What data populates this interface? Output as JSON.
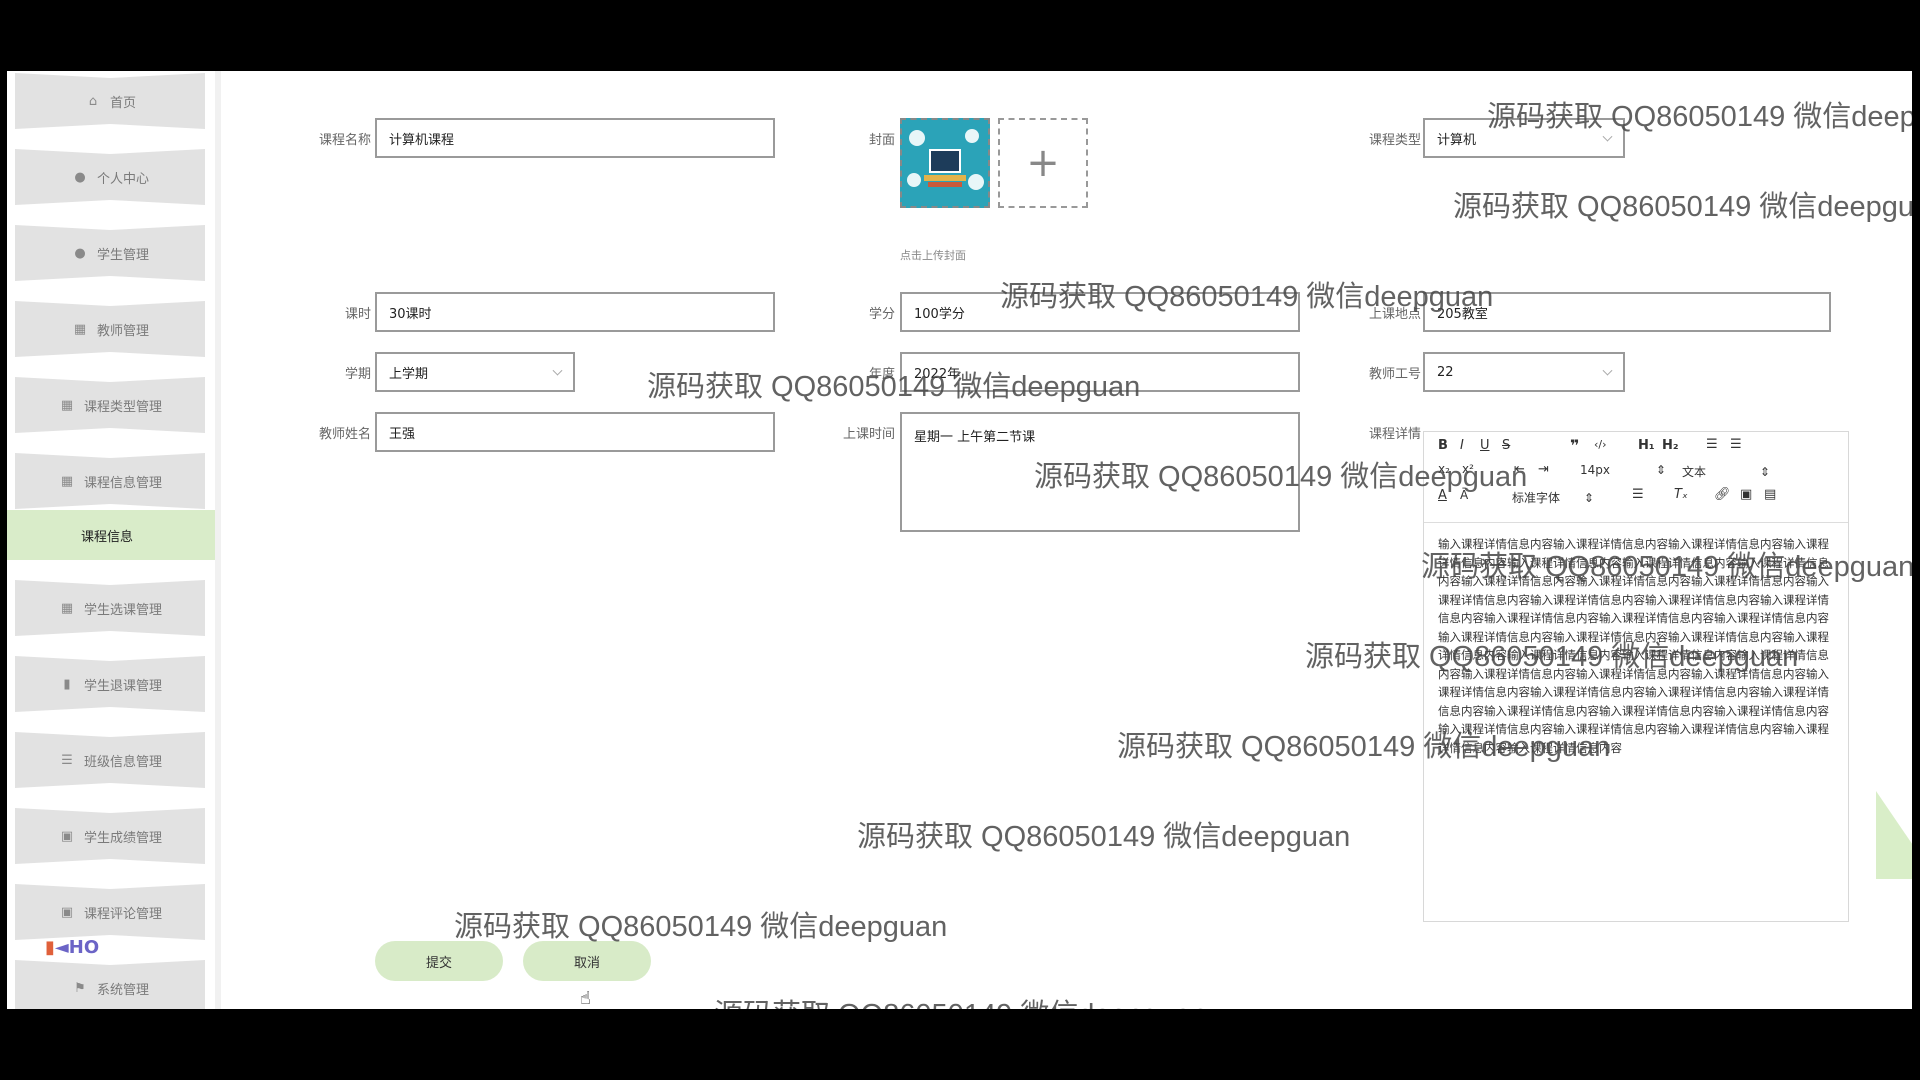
{
  "sidebar": {
    "items": [
      {
        "label": "首页",
        "icon": "home-icon"
      },
      {
        "label": "个人中心",
        "icon": "person-icon"
      },
      {
        "label": "学生管理",
        "icon": "user-icon"
      },
      {
        "label": "教师管理",
        "icon": "grid-icon"
      },
      {
        "label": "课程类型管理",
        "icon": "grid-icon"
      },
      {
        "label": "课程信息管理",
        "icon": "grid-icon"
      },
      {
        "label": "学生选课管理",
        "icon": "grid-icon"
      },
      {
        "label": "学生退课管理",
        "icon": "bar-chart-icon"
      },
      {
        "label": "班级信息管理",
        "icon": "list-icon"
      },
      {
        "label": "学生成绩管理",
        "icon": "clipboard-icon"
      },
      {
        "label": "课程评论管理",
        "icon": "clipboard-icon"
      },
      {
        "label": "系统管理",
        "icon": "flag-icon"
      }
    ],
    "active_sub": "课程信息",
    "logo_text": "HO"
  },
  "form": {
    "course_name": {
      "label": "课程名称",
      "value": "计算机课程"
    },
    "cover": {
      "label": "封面",
      "hint": "点击上传封面",
      "upload_symbol": "+"
    },
    "course_type": {
      "label": "课程类型",
      "value": "计算机"
    },
    "hours": {
      "label": "课时",
      "value": "30课时"
    },
    "credit": {
      "label": "学分",
      "value": "100学分"
    },
    "location": {
      "label": "上课地点",
      "value": "205教室"
    },
    "semester": {
      "label": "学期",
      "value": "上学期"
    },
    "year": {
      "label": "年度",
      "value": "2022年"
    },
    "teacher_id": {
      "label": "教师工号",
      "value": "22"
    },
    "teacher_name": {
      "label": "教师姓名",
      "value": "王强"
    },
    "class_time": {
      "label": "上课时间",
      "value": "星期一  上午第二节课"
    },
    "details": {
      "label": "课程详情",
      "toolbar": {
        "font_size": "14px",
        "paragraph": "文本",
        "font_family": "标准字体"
      },
      "content": "输入课程详情信息内容输入课程详情信息内容输入课程详情信息内容输入课程详情信息内容输入课程详情信息内容输入课程详情信息内容输入课程详情信息内容输入课程详情信息内容输入课程详情信息内容输入课程详情信息内容输入课程详情信息内容输入课程详情信息内容输入课程详情信息内容输入课程详情信息内容输入课程详情信息内容输入课程详情信息内容输入课程详情信息内容输入课程详情信息内容输入课程详情信息内容输入课程详情信息内容输入课程详情信息内容输入课程详情信息内容输入课程详情信息内容输入课程详情信息内容输入课程详情信息内容输入课程详情信息内容输入课程详情信息内容输入课程详情信息内容输入课程详情信息内容输入课程详情信息内容输入课程详情信息内容输入课程详情信息内容输入课程详情信息内容输入课程详情信息内容输入课程详情信息内容输入课程详情信息内容输入课程详情信息内容输入课程详情信息内容输入课程详情信息内容"
    }
  },
  "actions": {
    "submit": "提交",
    "cancel": "取消"
  },
  "watermark": "源码获取 QQ86050149 微信deepguan",
  "colors": {
    "accent": "#d8ebc8",
    "nav": "#e2e2e2"
  }
}
